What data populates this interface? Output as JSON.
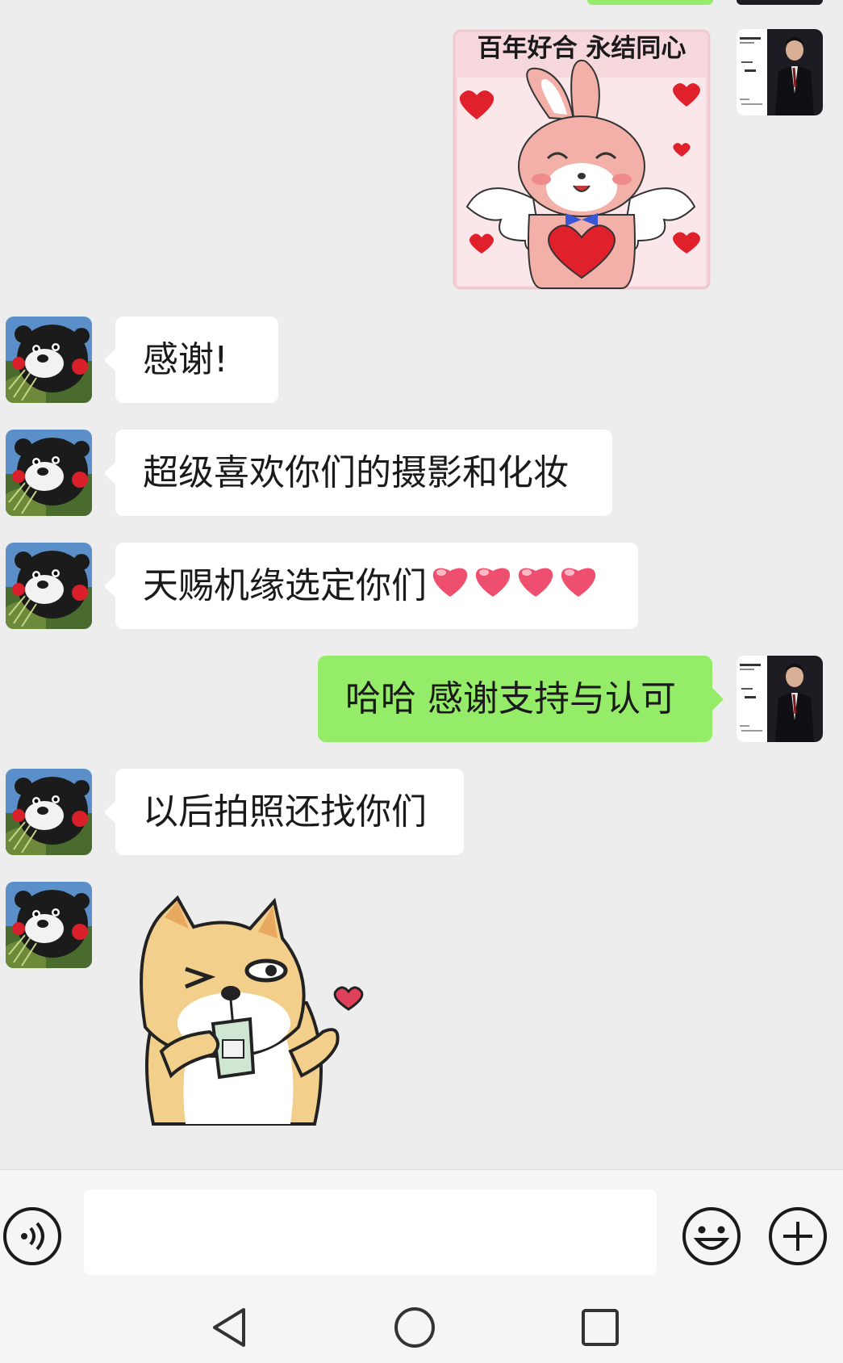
{
  "messages": [
    {
      "from": "self",
      "type": "sticker",
      "sticker_text": "百年好合 永结同心",
      "icon": "rabbit-angel-sticker"
    },
    {
      "from": "other",
      "type": "text",
      "text": "感谢!"
    },
    {
      "from": "other",
      "type": "text",
      "text": "超级喜欢你们的摄影和化妆"
    },
    {
      "from": "other",
      "type": "text",
      "text": "天赐机缘选定你们",
      "emoji": [
        "heart",
        "heart",
        "heart",
        "heart"
      ]
    },
    {
      "from": "self",
      "type": "text",
      "text": "哈哈 感谢支持与认可"
    },
    {
      "from": "other",
      "type": "text",
      "text": "以后拍照还找你们"
    },
    {
      "from": "other",
      "type": "sticker",
      "icon": "shiba-drinking-sticker"
    }
  ],
  "input_bar": {
    "voice_icon": "voice-icon",
    "emoji_icon": "emoji-icon",
    "plus_icon": "plus-icon",
    "placeholder": ""
  },
  "navbar": {
    "back_icon": "back-triangle-icon",
    "home_icon": "home-circle-icon",
    "recent_icon": "recent-square-icon"
  },
  "colors": {
    "background": "#ededed",
    "incoming_bubble": "#ffffff",
    "outgoing_bubble": "#95ec69"
  }
}
